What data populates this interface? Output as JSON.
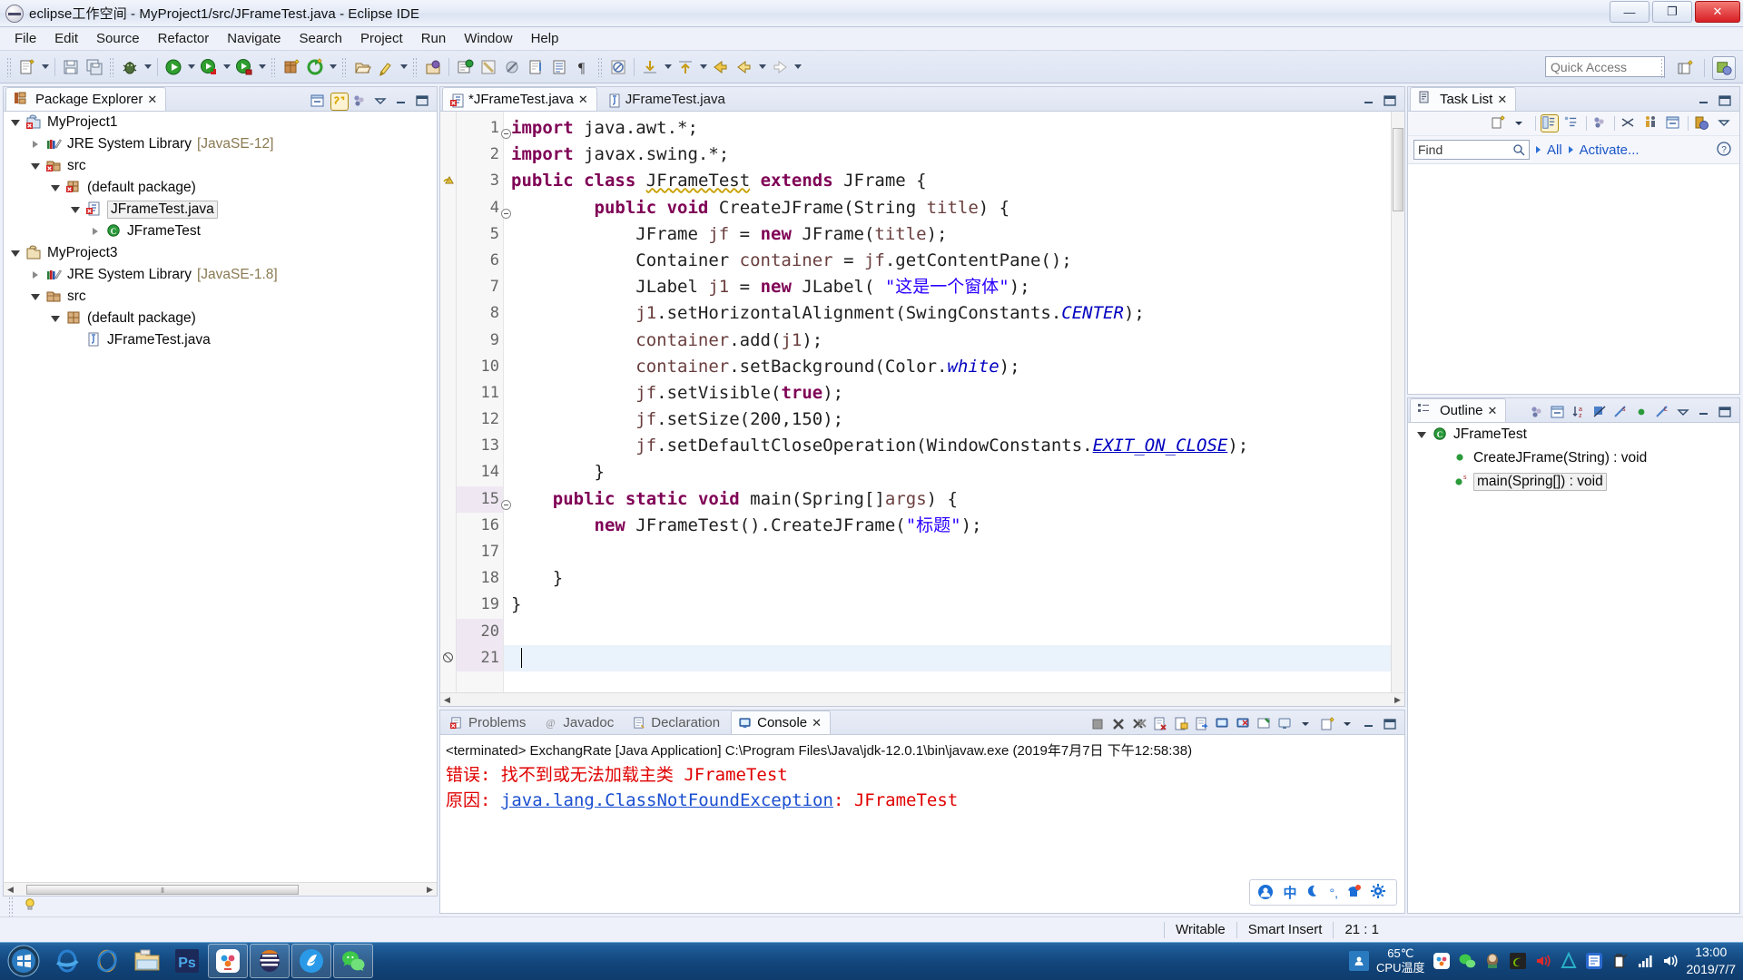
{
  "window": {
    "title": "eclipse工作空间 - MyProject1/src/JFrameTest.java - Eclipse IDE",
    "minimize": "—",
    "maximize": "❐",
    "close": "✕"
  },
  "menubar": {
    "items": [
      "File",
      "Edit",
      "Source",
      "Refactor",
      "Navigate",
      "Search",
      "Project",
      "Run",
      "Window",
      "Help"
    ]
  },
  "toolbar": {
    "quick_access_placeholder": "Quick Access",
    "icons": [
      "new-wizard-icon",
      "save-icon",
      "save-all-icon",
      "debug-icon",
      "run-icon",
      "run-as-java-icon",
      "run-coverage-icon",
      "new-java-package-icon",
      "external-tools-icon",
      "open-type-icon",
      "search-icon",
      "last-edit-location-icon",
      "next-annotation-icon",
      "previous-annotation-icon",
      "back-icon",
      "forward-icon",
      "toggle-mark-occurrences-icon",
      "skip-breakpoints-icon"
    ],
    "perspective_new_icon": "open-perspective-icon",
    "perspective_java_icon": "java-perspective-icon"
  },
  "package_explorer": {
    "tab_label": "Package Explorer",
    "close_glyph": "✕",
    "toolbar_icons": [
      "collapse-all-icon",
      "link-with-editor-icon",
      "view-menu-dots-icon",
      "view-menu-icon",
      "minimize-icon",
      "maximize-icon"
    ],
    "tree": [
      {
        "label": "MyProject1",
        "indent": 0,
        "twisty": "open",
        "icon": "java-project-error-icon",
        "selected": false
      },
      {
        "label": "JRE System Library",
        "dim": "[JavaSE-12]",
        "indent": 1,
        "twisty": "closed",
        "icon": "library-icon",
        "selected": false
      },
      {
        "label": "src",
        "indent": 1,
        "twisty": "open",
        "icon": "source-folder-error-icon",
        "selected": false
      },
      {
        "label": "(default package)",
        "indent": 2,
        "twisty": "open",
        "icon": "package-error-icon",
        "selected": false
      },
      {
        "label": "JFrameTest.java",
        "indent": 3,
        "twisty": "open",
        "icon": "java-file-error-icon",
        "selected": true
      },
      {
        "label": "JFrameTest",
        "indent": 4,
        "twisty": "closed",
        "icon": "class-icon",
        "selected": false
      },
      {
        "label": "MyProject3",
        "indent": 0,
        "twisty": "open",
        "icon": "java-project-icon",
        "selected": false
      },
      {
        "label": "JRE System Library",
        "dim": "[JavaSE-1.8]",
        "indent": 1,
        "twisty": "closed",
        "icon": "library-icon",
        "selected": false
      },
      {
        "label": "src",
        "indent": 1,
        "twisty": "open",
        "icon": "source-folder-icon",
        "selected": false
      },
      {
        "label": "(default package)",
        "indent": 2,
        "twisty": "open",
        "icon": "package-icon",
        "selected": false
      },
      {
        "label": "JFrameTest.java",
        "indent": 3,
        "twisty": "none",
        "icon": "java-file-icon",
        "selected": false
      }
    ]
  },
  "editor": {
    "tabs": [
      {
        "label": "*JFrameTest.java",
        "active": true,
        "icon": "java-file-error-icon",
        "close_glyph": "✕"
      },
      {
        "label": "JFrameTest.java",
        "active": false,
        "icon": "java-file-icon",
        "close_glyph": ""
      }
    ],
    "minimize": "—",
    "maximize": "❐",
    "lines": [
      {
        "n": "1",
        "fold": "minus",
        "marker": "",
        "text": "import java.awt.*;"
      },
      {
        "n": "2",
        "fold": "",
        "marker": "",
        "text": "import javax.swing.*;"
      },
      {
        "n": "3",
        "fold": "",
        "marker": "warning",
        "text": "public class JFrameTest extends JFrame {"
      },
      {
        "n": "4",
        "fold": "minus",
        "marker": "",
        "text": "        public void CreateJFrame(String title) {"
      },
      {
        "n": "5",
        "fold": "",
        "marker": "",
        "text": "            JFrame jf = new JFrame(title);"
      },
      {
        "n": "6",
        "fold": "",
        "marker": "",
        "text": "            Container container = jf.getContentPane();"
      },
      {
        "n": "7",
        "fold": "",
        "marker": "",
        "text": "            JLabel j1 = new JLabel( \"这是一个窗体\");"
      },
      {
        "n": "8",
        "fold": "",
        "marker": "",
        "text": "            j1.setHorizontalAlignment(SwingConstants.CENTER);"
      },
      {
        "n": "9",
        "fold": "",
        "marker": "",
        "text": "            container.add(j1);"
      },
      {
        "n": "10",
        "fold": "",
        "marker": "",
        "text": "            container.setBackground(Color.white);"
      },
      {
        "n": "11",
        "fold": "",
        "marker": "",
        "text": "            jf.setVisible(true);"
      },
      {
        "n": "12",
        "fold": "",
        "marker": "",
        "text": "            jf.setSize(200,150);"
      },
      {
        "n": "13",
        "fold": "",
        "marker": "",
        "text": "            jf.setDefaultCloseOperation(WindowConstants.EXIT_ON_CLOSE);"
      },
      {
        "n": "14",
        "fold": "",
        "marker": "",
        "text": "        }"
      },
      {
        "n": "15",
        "fold": "minus",
        "marker": "",
        "text": "    public static void main(Spring[]args) {"
      },
      {
        "n": "16",
        "fold": "",
        "marker": "",
        "text": "        new JFrameTest().CreateJFrame(\"标题\");"
      },
      {
        "n": "17",
        "fold": "",
        "marker": "",
        "text": ""
      },
      {
        "n": "18",
        "fold": "",
        "marker": "",
        "text": "    }"
      },
      {
        "n": "19",
        "fold": "",
        "marker": "",
        "text": "}"
      },
      {
        "n": "20",
        "fold": "",
        "marker": "",
        "text": ""
      },
      {
        "n": "21",
        "fold": "",
        "marker": "error",
        "text": ""
      }
    ]
  },
  "console": {
    "tabs": [
      {
        "label": "Problems",
        "active": false,
        "icon": "problems-icon"
      },
      {
        "label": "Javadoc",
        "active": false,
        "icon": "javadoc-icon"
      },
      {
        "label": "Declaration",
        "active": false,
        "icon": "declaration-icon"
      },
      {
        "label": "Console",
        "active": true,
        "icon": "console-icon",
        "close_glyph": "✕"
      }
    ],
    "toolbar_icons": [
      "terminate-icon",
      "remove-launch-icon",
      "remove-all-terminated-icon",
      "clear-console-icon",
      "scroll-lock-icon",
      "word-wrap-icon",
      "show-console-on-output-icon",
      "show-console-on-error-icon",
      "pin-console-icon",
      "display-selected-console-icon",
      "dropdown-icon",
      "open-console-icon",
      "dropdown-icon",
      "minimize-icon",
      "maximize-icon"
    ],
    "lines": [
      {
        "type": "terminated",
        "text": "<terminated> ExchangRate [Java Application] C:\\Program Files\\Java\\jdk-12.0.1\\bin\\javaw.exe (2019年7月7日 下午12:58:38)"
      },
      {
        "type": "error",
        "prefix": "错误: 找不到或无法加载主类 ",
        "mono": "JFrameTest"
      },
      {
        "type": "error_link",
        "prefix": "原因: ",
        "link": "java.lang.ClassNotFoundException",
        "suffix": ": JFrameTest"
      }
    ]
  },
  "ime": {
    "items": [
      "user-icon",
      "中",
      "moon-icon",
      "°,",
      "shirt-icon",
      "gear-icon"
    ]
  },
  "task_list": {
    "tab_label": "Task List",
    "close_glyph": "✕",
    "find_placeholder": "Find",
    "all_label": "All",
    "activate_label": "Activate...",
    "help_glyph": "?",
    "toolbar_icons": [
      "new-task-icon",
      "dropdown-icon",
      "categorized-icon",
      "flat-icon",
      "focus-icon",
      "filter-icon",
      "people-icon",
      "collapse-all-icon",
      "synchronize-icon",
      "view-menu-icon"
    ],
    "minimize": "—",
    "maximize": "❐"
  },
  "outline": {
    "tab_label": "Outline",
    "close_glyph": "✕",
    "toolbar_icons": [
      "focus-icon",
      "collapse-all-icon",
      "sort-icon",
      "hide-fields-icon",
      "hide-static-icon",
      "hide-nonpublic-icon",
      "hide-local-icon",
      "view-menu-icon"
    ],
    "minimize": "—",
    "maximize": "❐",
    "tree": [
      {
        "label": "JFrameTest",
        "indent": 0,
        "twisty": "open",
        "icon": "class-icon",
        "selected": false
      },
      {
        "label": "CreateJFrame(String) : void",
        "indent": 1,
        "twisty": "none",
        "icon": "public-method-icon",
        "selected": false
      },
      {
        "label": "main(Spring[]) : void",
        "indent": 1,
        "twisty": "none",
        "icon": "public-static-method-icon",
        "selected": true,
        "static_badge": "S"
      }
    ]
  },
  "status_bar": {
    "writable": "Writable",
    "insert_mode": "Smart Insert",
    "position": "21 : 1",
    "lightbulb_icon": "quick-fix-bulb-icon"
  },
  "taskbar": {
    "start_icon": "windows-start-orb",
    "pinned": [
      "internet-explorer-icon",
      "internet-explorer-2-icon",
      "file-explorer-icon",
      "photoshop-icon"
    ],
    "running": [
      "baidu-netdisk-icon",
      "eclipse-icon",
      "browser-icon",
      "wechat-icon"
    ],
    "tray_icons": [
      "show-hidden-icon",
      "netdisk-icon",
      "wechat-tray-icon",
      "qq-tray-icon",
      "nvidia-icon",
      "volume-icon",
      "autodesk-icon",
      "driver-icon",
      "cleaner-icon",
      "network-icon",
      "speaker-icon"
    ],
    "cpu_temp_value": "65℃",
    "cpu_temp_label": "CPU温度",
    "time": "13:00",
    "date": "2019/7/7"
  },
  "colors": {
    "keyword": "#7f0055",
    "string": "#2a00ff",
    "static_field": "#0000c0",
    "error_red": "#e00000",
    "link_blue": "#1a4fd0",
    "accent": "#1a55c8"
  }
}
